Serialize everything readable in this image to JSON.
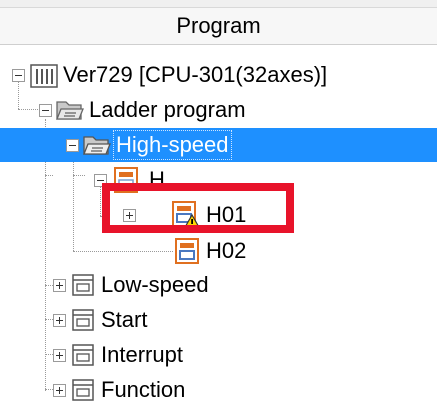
{
  "header": {
    "title": "Program"
  },
  "tree": {
    "root": {
      "label": "Ver729 [CPU-301(32axes)]",
      "icon": "cpu-icon"
    },
    "ladder": {
      "label": "Ladder program",
      "icon": "folder-open-icon"
    },
    "high_speed": {
      "label": "High-speed",
      "icon": "folder-open-icon",
      "selected": true
    },
    "h": {
      "label": "H",
      "icon": "program-file-icon"
    },
    "h01": {
      "label": "H01",
      "icon": "program-file-warning-icon",
      "warning": true
    },
    "h02": {
      "label": "H02",
      "icon": "program-file-icon"
    },
    "low_speed": {
      "label": "Low-speed",
      "icon": "program-group-icon"
    },
    "start": {
      "label": "Start",
      "icon": "program-group-icon"
    },
    "interrupt": {
      "label": "Interrupt",
      "icon": "program-group-icon"
    },
    "function": {
      "label": "Function",
      "icon": "program-group-icon"
    }
  },
  "colors": {
    "selection": "#1e90ff",
    "highlight_box": "#e8132a"
  }
}
